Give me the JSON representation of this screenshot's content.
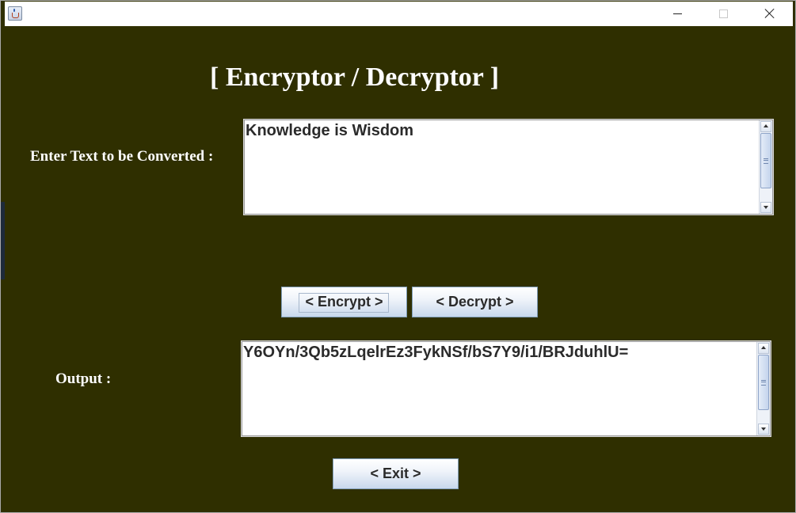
{
  "window": {
    "app_icon": "java-cup-icon",
    "controls": [
      "minimize-icon",
      "maximize-icon",
      "close-icon"
    ]
  },
  "heading": "[ Encryptor / Decryptor ]",
  "input": {
    "label": "Enter Text to be Converted :",
    "value": "Knowledge is Wisdom"
  },
  "buttons": {
    "encrypt": "< Encrypt >",
    "decrypt": "< Decrypt >",
    "exit": "< Exit >"
  },
  "output": {
    "label": "Output :",
    "value": "Y6OYn/3Qb5zLqelrEz3FykNSf/bS7Y9/i1/BRJduhlU="
  },
  "colors": {
    "background": "#2f2f00",
    "text": "#ffffff",
    "button_gradient_bottom": "#c8d8ec"
  }
}
